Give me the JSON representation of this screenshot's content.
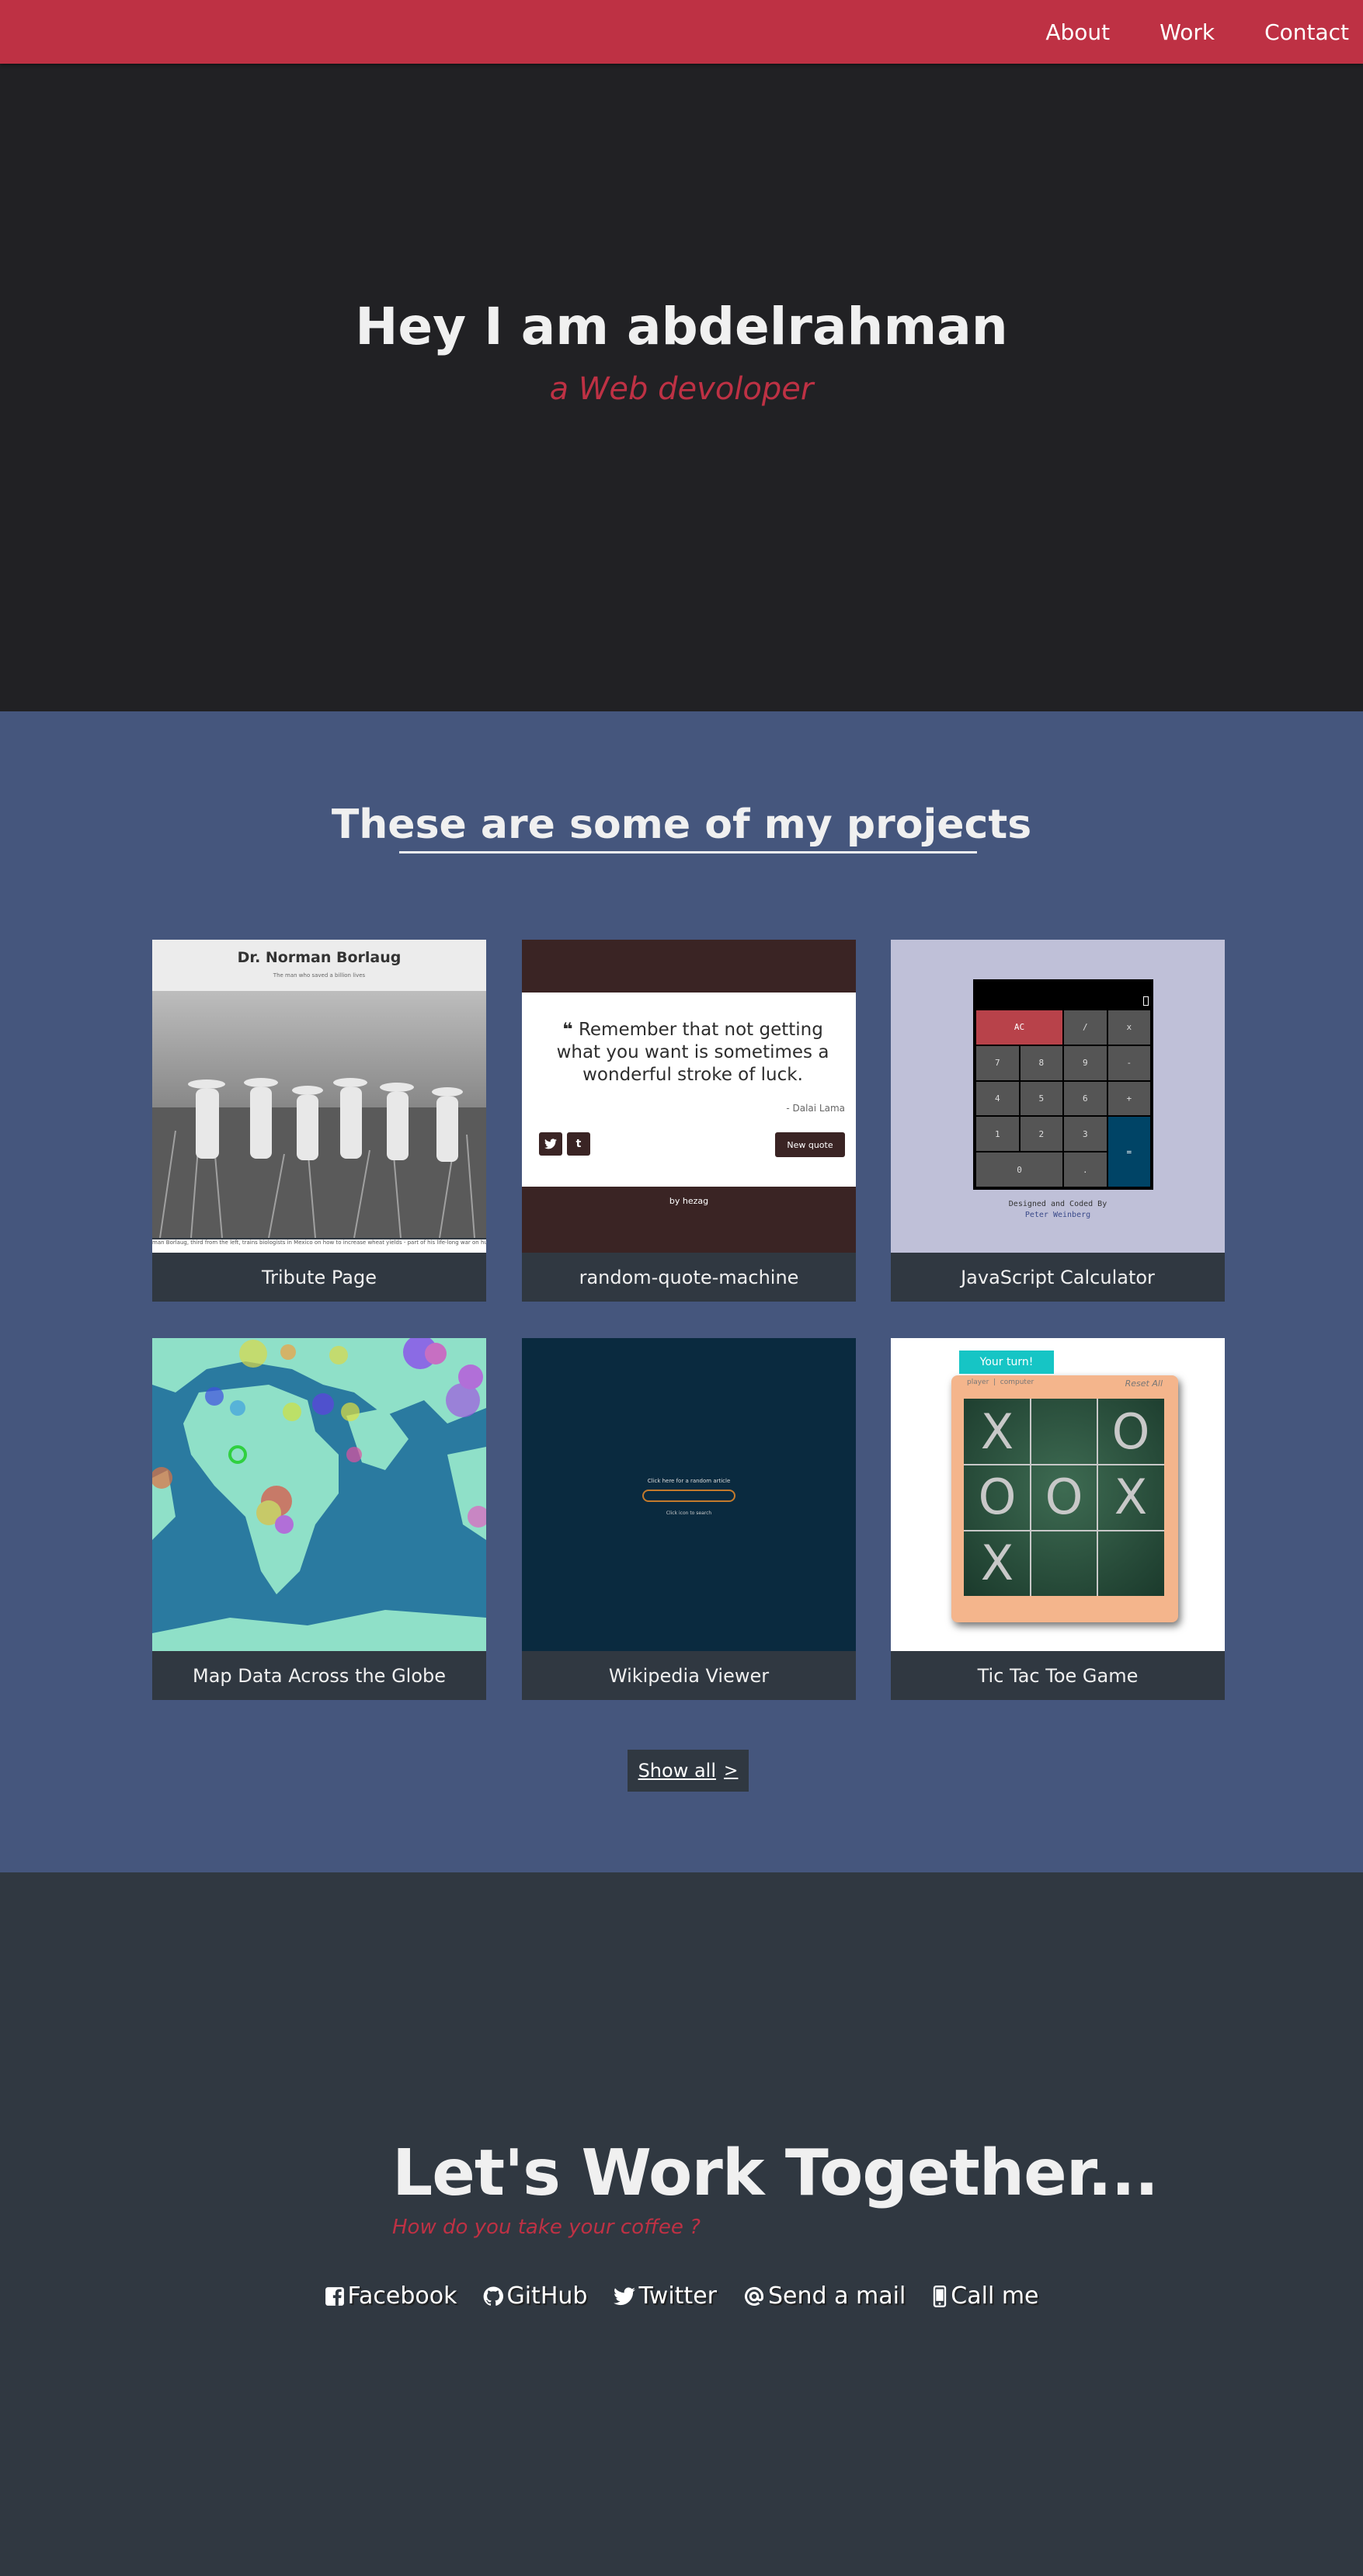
{
  "nav": {
    "links": [
      "About",
      "Work",
      "Contact"
    ]
  },
  "hero": {
    "title": "Hey I am abdelrahman",
    "subtitle": "a Web devoloper"
  },
  "projects": {
    "heading": "These are some of my projects",
    "tiles": [
      {
        "label": "Tribute Page",
        "preview": {
          "title": "Dr. Norman Borlaug",
          "subtitle": "The man who saved a billion lives",
          "caption": "man Borlaug, third from the left, trains biologists in Mexico on how to increase wheat yields - part of his life-long war on hunger."
        }
      },
      {
        "label": "random-quote-machine",
        "preview": {
          "quote": "Remember that not getting what you want is sometimes a wonderful stroke of luck.",
          "author": "- Dalai Lama",
          "button": "New quote",
          "footer": "by hezag",
          "share_icons": [
            "twitter-icon",
            "tumblr-icon"
          ]
        }
      },
      {
        "label": "JavaScript Calculator",
        "preview": {
          "keys": [
            "AC",
            "/",
            "x",
            "7",
            "8",
            "9",
            "-",
            "4",
            "5",
            "6",
            "+",
            "1",
            "2",
            "3",
            "=",
            "0",
            "."
          ],
          "footer_line1": "Designed and Coded By",
          "footer_line2": "Peter Weinberg"
        }
      },
      {
        "label": "Map Data Across the Globe"
      },
      {
        "label": "Wikipedia Viewer",
        "preview": {
          "top_text": "Click here for a random article",
          "bottom_text": "Click icon to search"
        }
      },
      {
        "label": "Tic Tac Toe Game",
        "preview": {
          "turn": "Your turn!",
          "player": "player",
          "computer": "computer",
          "reset": "Reset All",
          "board": [
            "X",
            "",
            "O",
            "O",
            "O",
            "X",
            "X",
            "",
            ""
          ]
        }
      }
    ],
    "show_all": {
      "label": "Show all",
      "chevron": ">"
    }
  },
  "contact": {
    "heading": "Let's Work Together...",
    "subheading": "How do you take your coffee ?",
    "links": [
      {
        "label": "Facebook",
        "icon": "facebook-icon"
      },
      {
        "label": "GitHub",
        "icon": "github-icon"
      },
      {
        "label": "Twitter",
        "icon": "twitter-icon"
      },
      {
        "label": "Send a mail",
        "icon": "at-icon"
      },
      {
        "label": "Call me",
        "icon": "phone-icon"
      }
    ]
  },
  "colors": {
    "nav": "#be3144",
    "hero_bg": "#212124",
    "projects_bg": "#45567d",
    "contact_bg": "#303841",
    "accent": "#be3144"
  }
}
